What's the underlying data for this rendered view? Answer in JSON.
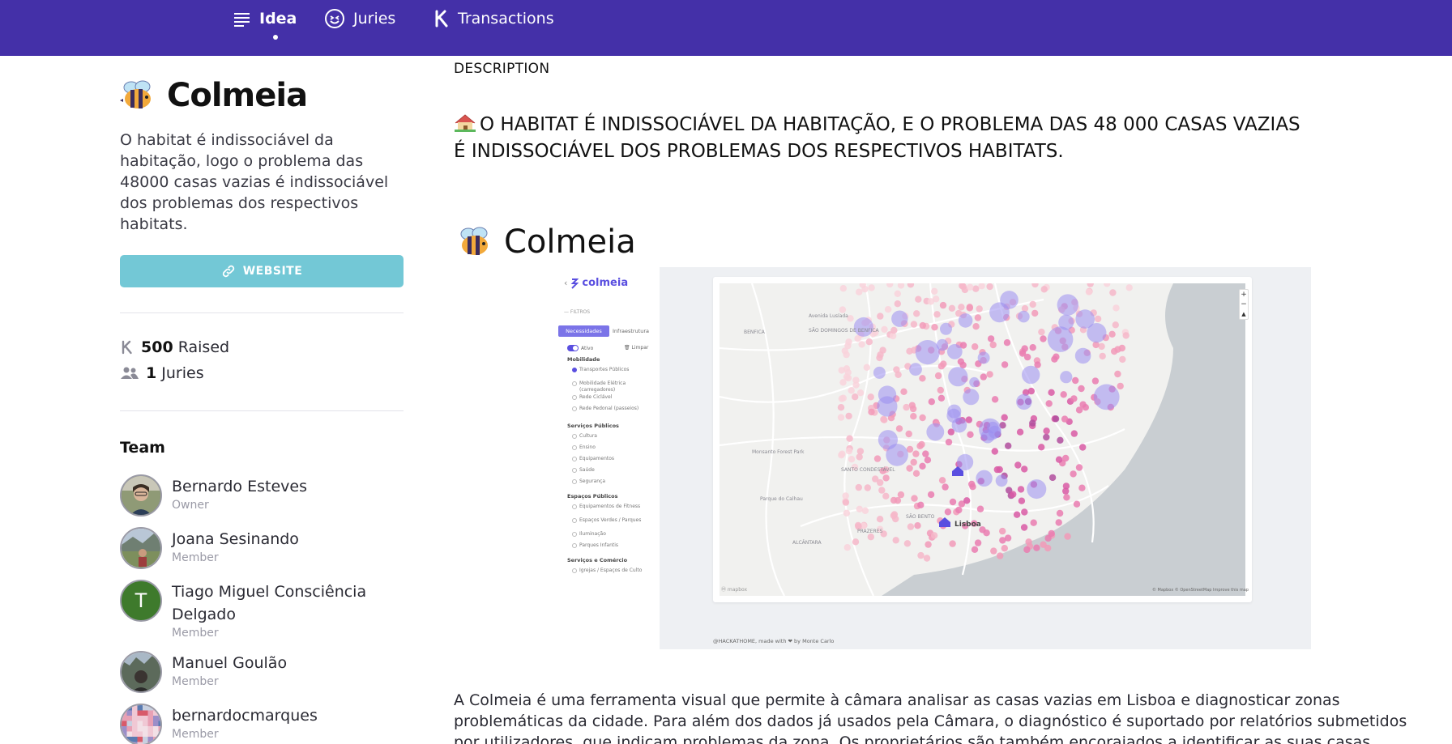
{
  "nav": {
    "items": [
      {
        "label": "Idea",
        "icon": "list-icon",
        "active": true
      },
      {
        "label": "Juries",
        "icon": "smiley-icon",
        "active": false
      },
      {
        "label": "Transactions",
        "icon": "k-currency-icon",
        "active": false
      }
    ]
  },
  "project": {
    "name": "Colmeia",
    "summary": "O habitat é indissociável da habitação, logo o problema das 48000 casas vazias é indissociável dos problemas dos respectivos habitats.",
    "website_label": "WEBSITE",
    "raised_value": "500",
    "raised_label": "Raised",
    "juries_value": "1",
    "juries_label": "Juries"
  },
  "team": {
    "title": "Team",
    "members": [
      {
        "name": "Bernardo Esteves",
        "role": "Owner"
      },
      {
        "name": "Joana Sesinando",
        "role": "Member"
      },
      {
        "name": "Tiago Miguel Consciência Delgado",
        "role": "Member",
        "initial": "T"
      },
      {
        "name": "Manuel Goulão",
        "role": "Member"
      },
      {
        "name": "bernardocmarques",
        "role": "Member"
      }
    ]
  },
  "description": {
    "label": "DESCRIPTION",
    "headline": "O HABITAT É INDISSOCIÁVEL DA HABITAÇÃO, E O PROBLEMA DAS 48 000 CASAS VAZIAS É INDISSOCIÁVEL DOS PROBLEMAS DOS RESPECTIVOS HABITATS.",
    "section_title": "Colmeia",
    "body": "A Colmeia é uma ferramenta visual que permite à câmara analisar as casas vazias em Lisboa e diagnosticar zonas problemáticas da cidade. Para além dos dados já usados pela Câmara, o diagnóstico é suportado por relatórios submetidos por utilizadores, que indicam problemas da zona. Os proprietários são também encorajados a identificar as suas casas"
  },
  "embedded_app": {
    "logo_text": "colmeia",
    "filters_label": "FILTROS",
    "tab_active": "Necessidades",
    "tab_other": "Infraestrutura",
    "toggle_label": "Ativo",
    "clear_label": "Limpar",
    "groups": [
      {
        "title": "Mobilidade",
        "items": [
          "Transportes Públicos",
          "Mobilidade Elétrica (carregadores)",
          "Rede Ciclável",
          "Rede Pedonal (passeios)"
        ]
      },
      {
        "title": "Serviços Públicos",
        "items": [
          "Cultura",
          "Ensino",
          "Equipamentos",
          "Saúde",
          "Segurança"
        ]
      },
      {
        "title": "Espaços Públicos",
        "items": [
          "Equipamentos de Fitness",
          "Espaços Verdes / Parques",
          "Iluminação",
          "Parques Infantis"
        ]
      },
      {
        "title": "Serviços e Comércio",
        "items": [
          "Igrejas / Espaços de Culto"
        ]
      }
    ],
    "map_labels": [
      "SÃO DOMINGOS DE BENFICA",
      "BENFICA",
      "Avenida Lusíada",
      "Monsanto Forest Park",
      "Parque do Calhau",
      "SANTO CONDESTÁVEL",
      "Lisboa",
      "ALCÂNTARA",
      "PRAZERES",
      "SÃO BENTO"
    ],
    "attribution": "© Mapbox © OpenStreetMap Improve this map",
    "footer": "@HACKATHOME, made with ❤ by Monte Carlo",
    "zoom_in": "+",
    "zoom_out": "−"
  },
  "colors": {
    "nav_bg": "#4430a8",
    "website_btn": "#73c8d6",
    "accent_purple": "#5a4fe0"
  }
}
